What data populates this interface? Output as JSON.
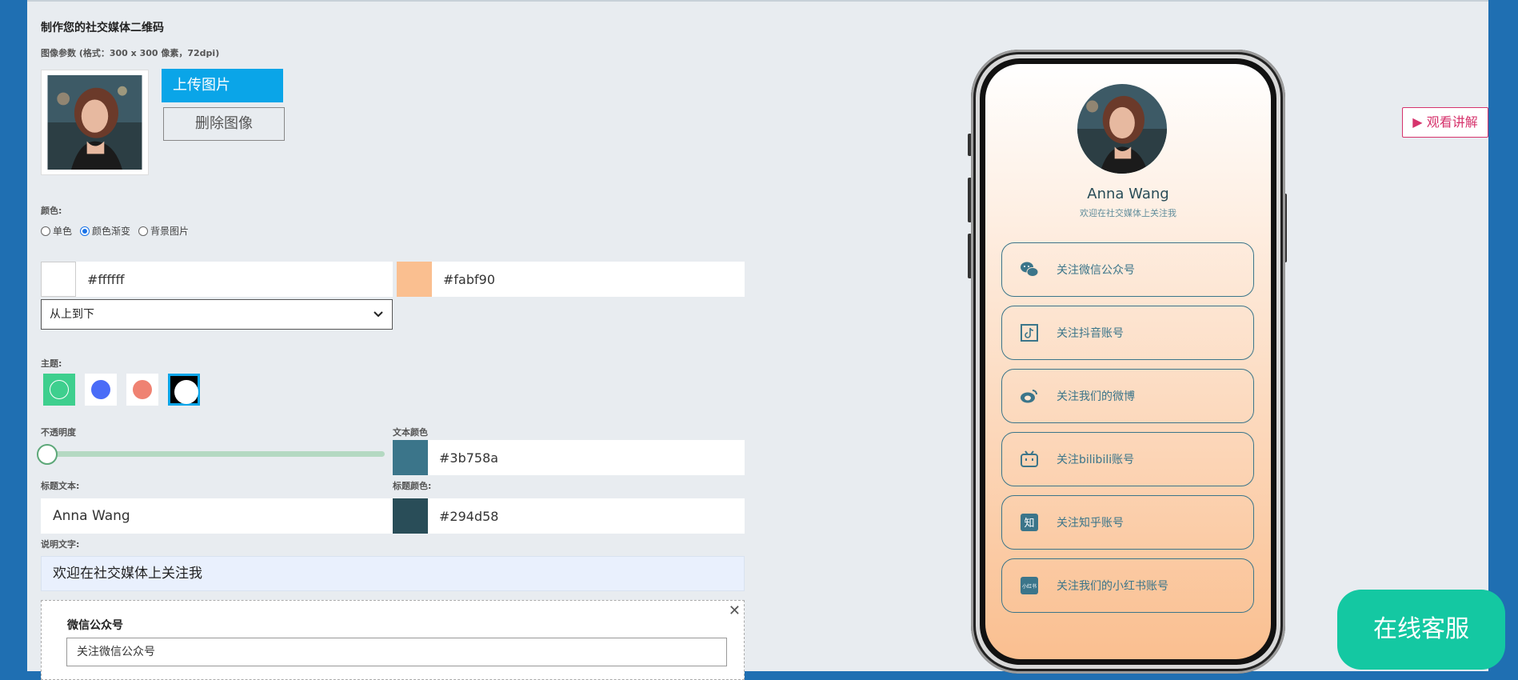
{
  "header": {
    "title": "制作您的社交媒体二维码",
    "image_params": "图像参数 (格式：300 x 300 像素，72dpi)"
  },
  "image": {
    "upload_label": "上传图片",
    "delete_label": "删除图像"
  },
  "color": {
    "label": "颜色:",
    "options": [
      "单色",
      "颜色渐变",
      "背景图片"
    ],
    "selected": "颜色渐变",
    "gradient_start": "#ffffff",
    "gradient_end": "#fabf90",
    "direction": "从上到下"
  },
  "theme": {
    "label": "主题:",
    "options": [
      {
        "bg": "#3ecf8e",
        "dot": "#3ecf8e",
        "ring": "#ffffff"
      },
      {
        "bg": "#ffffff",
        "dot": "#4a6cf7"
      },
      {
        "bg": "#ffffff",
        "dot": "#ef8272"
      },
      {
        "bg": "#000000",
        "dot": "#ffffff"
      }
    ],
    "selected_index": 3
  },
  "opacity": {
    "label": "不透明度",
    "value": 0
  },
  "text_color": {
    "label": "文本颜色",
    "value": "#3b758a"
  },
  "title_text": {
    "label": "标题文本:",
    "value": "Anna Wang"
  },
  "title_color": {
    "label": "标题颜色:",
    "value": "#294d58"
  },
  "description": {
    "label": "说明文字:",
    "value": "欢迎在社交媒体上关注我"
  },
  "wechat_card": {
    "title": "微信公众号",
    "value": "关注微信公众号"
  },
  "preview": {
    "name": "Anna Wang",
    "desc": "欢迎在社交媒体上关注我",
    "links": [
      {
        "icon": "wechat-icon",
        "label": "关注微信公众号"
      },
      {
        "icon": "douyin-icon",
        "label": "关注抖音账号"
      },
      {
        "icon": "weibo-icon",
        "label": "关注我们的微博"
      },
      {
        "icon": "bilibili-icon",
        "label": "关注bilibili账号"
      },
      {
        "icon": "zhihu-icon",
        "label": "关注知乎账号"
      },
      {
        "icon": "xiaohongshu-icon",
        "label": "关注我们的小红书账号"
      }
    ]
  },
  "watch_button": "观看讲解",
  "service_button": "在线客服"
}
